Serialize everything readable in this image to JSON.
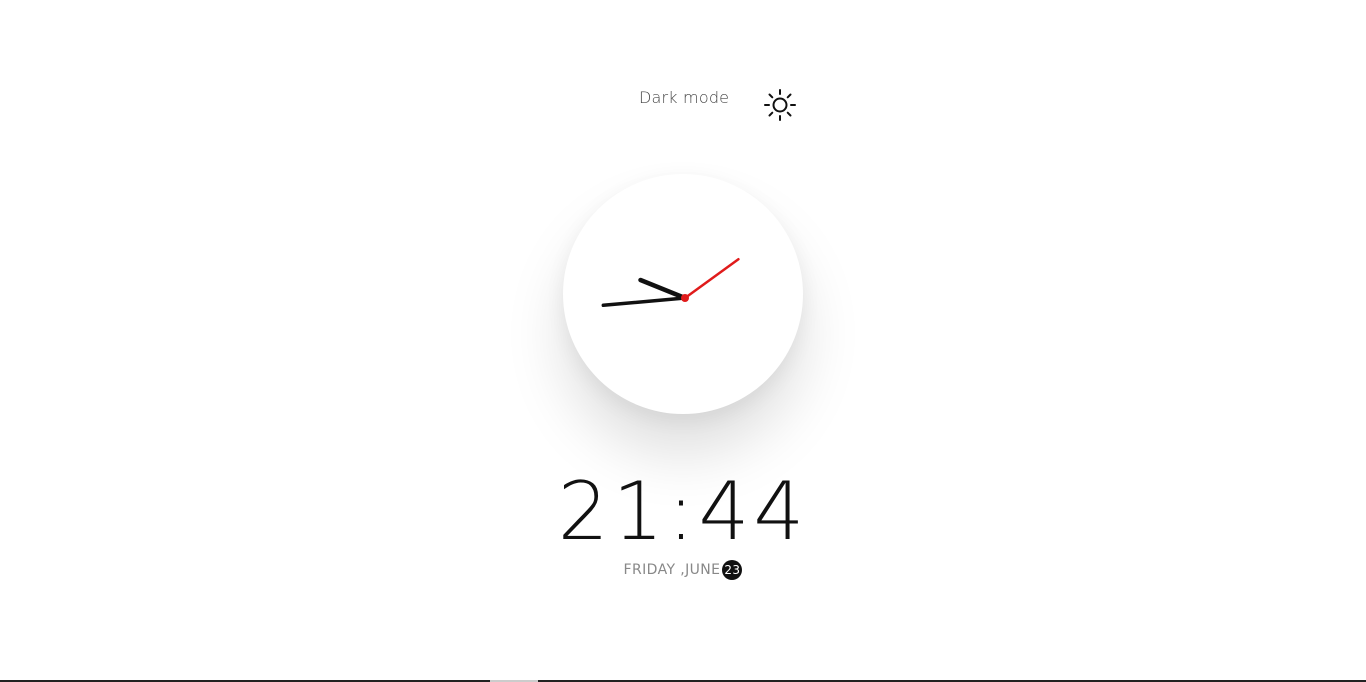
{
  "theme_toggle": {
    "label": "Dark mode",
    "icon": "sun-icon"
  },
  "clock": {
    "hour": 21,
    "minute": 44,
    "second": 9,
    "hand_colors": {
      "hour": "#111111",
      "minute": "#111111",
      "second": "#e01b1b"
    }
  },
  "digital": {
    "time": "21:44"
  },
  "date": {
    "weekday_month": "FRIDAY ,JUNE",
    "day": "23"
  }
}
